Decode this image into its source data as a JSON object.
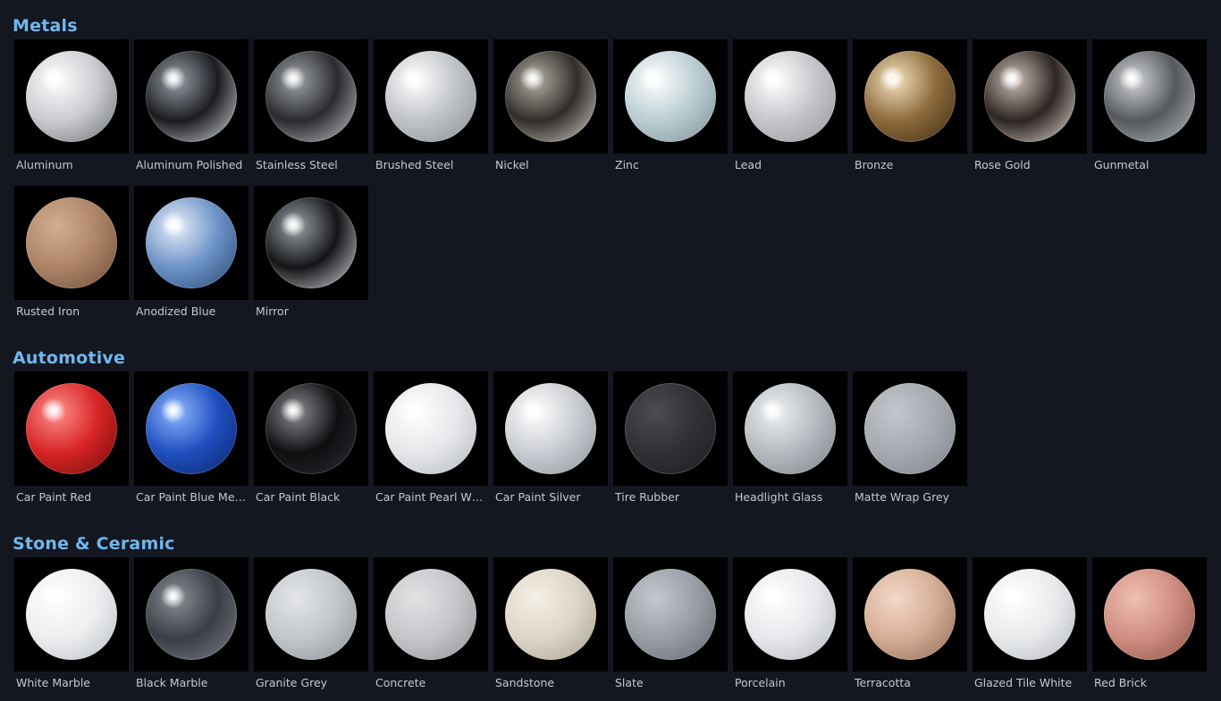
{
  "sections": [
    {
      "title": "Metals",
      "materials": [
        {
          "name": "Aluminum",
          "colors": [
            "#ffffff",
            "#c9cbcf",
            "#6b6e74"
          ],
          "spec": "#ffffff"
        },
        {
          "name": "Aluminum Polished",
          "colors": [
            "#9aa0a8",
            "#1b1c1f",
            "#d9dde2"
          ],
          "spec": "#ffffff"
        },
        {
          "name": "Stainless Steel",
          "colors": [
            "#a0a4aa",
            "#2a2b2e",
            "#c7cacf"
          ],
          "spec": "#ffffff"
        },
        {
          "name": "Brushed Steel",
          "colors": [
            "#ffffff",
            "#bfc2c7",
            "#8a8d92"
          ],
          "spec": "#ffffff"
        },
        {
          "name": "Nickel",
          "colors": [
            "#b5b0a5",
            "#302d29",
            "#d8d4cc"
          ],
          "spec": "#ffffff"
        },
        {
          "name": "Zinc",
          "colors": [
            "#ffffff",
            "#b9cdd3",
            "#7f9096"
          ],
          "spec": "#ffffff"
        },
        {
          "name": "Lead",
          "colors": [
            "#ffffff",
            "#c4c6ca",
            "#93959a"
          ],
          "spec": "#ffffff"
        },
        {
          "name": "Bronze",
          "colors": [
            "#f4e2c2",
            "#8d6a3a",
            "#3b2c1a"
          ],
          "spec": "#fff4dc"
        },
        {
          "name": "Rose Gold",
          "colors": [
            "#cdbfb6",
            "#2c2522",
            "#e7ddd6"
          ],
          "spec": "#ffffff"
        },
        {
          "name": "Gunmetal",
          "colors": [
            "#d2d4d8",
            "#55585d",
            "#b8bbc0"
          ],
          "spec": "#ffffff"
        }
      ]
    },
    {
      "title": "",
      "materials": [
        {
          "name": "Rusted Iron",
          "colors": [
            "#d4ae92",
            "#ad8468",
            "#6b4c38"
          ],
          "spec": ""
        },
        {
          "name": "Anodized Blue",
          "colors": [
            "#e7eef8",
            "#6d93c8",
            "#26446e"
          ],
          "spec": "#ffffff"
        },
        {
          "name": "Mirror",
          "colors": [
            "#9da2a8",
            "#141517",
            "#dadee3"
          ],
          "spec": "#ffffff"
        }
      ]
    },
    {
      "title": "Automotive",
      "materials": [
        {
          "name": "Car Paint Red",
          "colors": [
            "#ff8f8f",
            "#d82424",
            "#6a0c0c"
          ],
          "spec": "#ffffff"
        },
        {
          "name": "Car Paint Blue Meta…",
          "colors": [
            "#8fb6ff",
            "#1f4fbf",
            "#0b2366"
          ],
          "spec": "#ffffff"
        },
        {
          "name": "Car Paint Black",
          "colors": [
            "#8a8d92",
            "#0e0f11",
            "#2b2d31"
          ],
          "spec": "#ffffff"
        },
        {
          "name": "Car Paint Pearl Whi…",
          "colors": [
            "#ffffff",
            "#e5e7ea",
            "#b3b6bb"
          ],
          "spec": "#ffffff"
        },
        {
          "name": "Car Paint Silver",
          "colors": [
            "#ffffff",
            "#c9ccd1",
            "#8e9197"
          ],
          "spec": "#ffffff"
        },
        {
          "name": "Tire Rubber",
          "colors": [
            "#4a4c51",
            "#2f3135",
            "#1c1d20"
          ],
          "spec": ""
        },
        {
          "name": "Headlight Glass",
          "colors": [
            "#eef0f2",
            "#b6babf",
            "#7d8187"
          ],
          "spec": "#ffffff"
        },
        {
          "name": "Matte Wrap Grey",
          "colors": [
            "#c3c7cc",
            "#a6aab0",
            "#7f8389"
          ],
          "spec": ""
        }
      ]
    },
    {
      "title": "Stone & Ceramic",
      "materials": [
        {
          "name": "White Marble",
          "colors": [
            "#ffffff",
            "#eceef0",
            "#b9bcc0"
          ],
          "spec": "#ffffff"
        },
        {
          "name": "Black Marble",
          "colors": [
            "#8a8e96",
            "#3b3e45",
            "#7d8088"
          ],
          "spec": "#ffffff"
        },
        {
          "name": "Granite Grey",
          "colors": [
            "#e4e6e9",
            "#c2c5c9",
            "#8c8f94"
          ],
          "spec": ""
        },
        {
          "name": "Concrete",
          "colors": [
            "#e2e3e5",
            "#c4c6c9",
            "#8e9094"
          ],
          "spec": ""
        },
        {
          "name": "Sandstone",
          "colors": [
            "#f4f0e6",
            "#ddd6c6",
            "#a59e8e"
          ],
          "spec": ""
        },
        {
          "name": "Slate",
          "colors": [
            "#c5c9cf",
            "#999da4",
            "#62666d"
          ],
          "spec": ""
        },
        {
          "name": "Porcelain",
          "colors": [
            "#ffffff",
            "#e6e8eb",
            "#b2b5ba"
          ],
          "spec": "#ffffff"
        },
        {
          "name": "Terracotta",
          "colors": [
            "#f4d8c8",
            "#d6ad96",
            "#8d6854"
          ],
          "spec": ""
        },
        {
          "name": "Glazed Tile White",
          "colors": [
            "#ffffff",
            "#e8eaec",
            "#b5b8bc"
          ],
          "spec": "#ffffff"
        },
        {
          "name": "Red Brick",
          "colors": [
            "#f0bfb4",
            "#cf8d80",
            "#8a5248"
          ],
          "spec": ""
        }
      ]
    }
  ]
}
